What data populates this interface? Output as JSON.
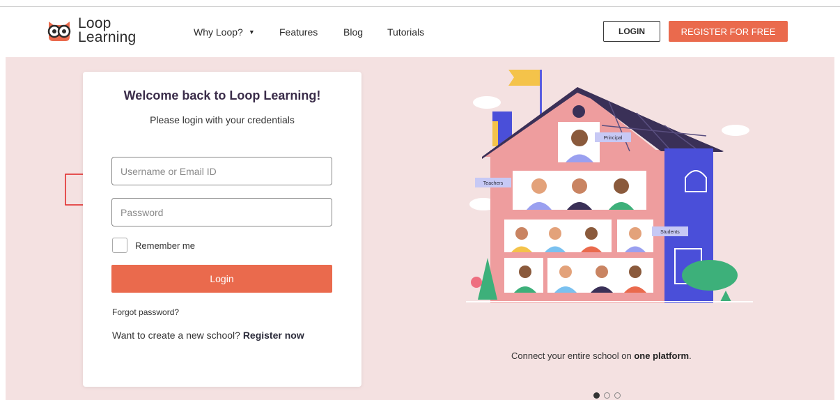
{
  "brand": {
    "line1": "Loop",
    "line2": "Learning"
  },
  "nav": {
    "why_loop": "Why Loop?",
    "features": "Features",
    "blog": "Blog",
    "tutorials": "Tutorials"
  },
  "header_buttons": {
    "login": "LOGIN",
    "register": "REGISTER FOR FREE"
  },
  "login_card": {
    "title": "Welcome back to Loop Learning!",
    "subtitle": "Please login with your credentials",
    "username_placeholder": "Username or Email ID",
    "username_value": "",
    "password_placeholder": "Password",
    "password_value": "",
    "remember_label": "Remember me",
    "remember_checked": false,
    "login_button": "Login",
    "forgot_password": "Forgot password?",
    "create_prefix": "Want to create a new school?",
    "create_link": "Register now"
  },
  "illustration": {
    "labels": {
      "principal": "Principal",
      "teachers": "Teachers",
      "students": "Students"
    }
  },
  "carousel": {
    "caption_prefix": "Connect your entire school on",
    "caption_bold": "one platform",
    "caption_suffix": ".",
    "slide_count": 3,
    "active_index": 0
  },
  "colors": {
    "accent": "#ea6a4d",
    "hero_bg": "#f4e1e1",
    "house_pink": "#ee9d9e",
    "roof": "#3a3057",
    "tower_blue": "#4a4fd9",
    "annotation_arrow": "#e02020"
  }
}
